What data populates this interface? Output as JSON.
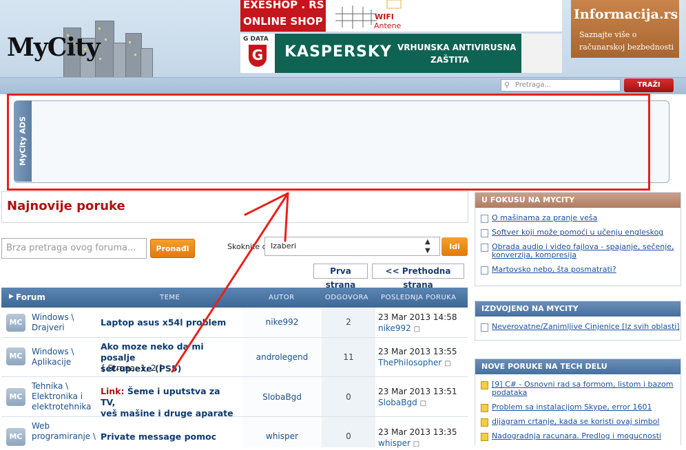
{
  "header": {
    "logo": "MyCity",
    "banner_exeshop_line1": "EXESHOP . RS",
    "banner_exeshop_line2": "ONLINE SHOP",
    "banner_wifi_line1": "WIFI",
    "banner_wifi_line2": "Antene",
    "banner_gdata": "G DATA",
    "banner_kaspersky": "KASPERSKY",
    "banner_kaspersky_line1": "VRHUNSKA ANTIVIRUSNA",
    "banner_kaspersky_line2": "ZAŠTITA",
    "banner_info_title": "Informacija.rs",
    "banner_info_line1": "Saznajte više o",
    "banner_info_line2": "računarskoj bezbednosti",
    "search_placeholder": "Pretraga...",
    "search_button": "TRAŽI"
  },
  "ads": {
    "label": "MyCity ADS"
  },
  "forum": {
    "title": "Najnovije poruke",
    "quick_search_placeholder": "Brza pretraga ovog foruma...",
    "find_button": "Pronađi",
    "jump_label": "Skoknite do:",
    "jump_selected": "Izaberi",
    "go_button": "Idi",
    "first_page": "Prva strana",
    "prev_page": "<< Prethodna strana",
    "columns": {
      "forum": "Forum",
      "topics": "TEME",
      "author": "AUTOR",
      "replies": "ODGOVORA",
      "last": "POSLEDNJA PORUKA"
    },
    "rows": [
      {
        "icon": "MC",
        "forum_l1": "Windows \\",
        "forum_l2": "Drajveri",
        "forum_l3": "",
        "prefix": "",
        "topic_l1": "Laptop asus x54l problem",
        "topic_l2": "",
        "pages_label": "",
        "author": "nike992",
        "replies": "2",
        "last_date": "23 Mar 2013 14:58",
        "last_user": "nike992"
      },
      {
        "icon": "MC",
        "forum_l1": "Windows \\",
        "forum_l2": "Aplikacije",
        "forum_l3": "",
        "prefix": "",
        "topic_l1": "Ako moze neko da mi posalje",
        "topic_l2": "set-up.exe (PS5)",
        "pages_label": "[ Strana: 1, 2 ]",
        "author": "androlegend",
        "replies": "11",
        "last_date": "23 Mar 2013 13:55",
        "last_user": "ThePhilosopher"
      },
      {
        "icon": "MC",
        "forum_l1": "Tehnika \\",
        "forum_l2": "Elektronika i",
        "forum_l3": "elektrotehnika",
        "prefix": "Link:",
        "topic_l1": "Šeme i uputstva za TV,",
        "topic_l2": "veš mašine i druge aparate",
        "pages_label": "",
        "author": "SlobaBgd",
        "replies": "0",
        "last_date": "23 Mar 2013 13:51",
        "last_user": "SlobaBgd"
      },
      {
        "icon": "MC",
        "forum_l1": "Web",
        "forum_l2": "programiranje \\",
        "forum_l3": "",
        "prefix": "",
        "topic_l1": "Private message pomoc",
        "topic_l2": "",
        "pages_label": "",
        "author": "whisper",
        "replies": "0",
        "last_date": "23 Mar 2013 13:35",
        "last_user": "whisper"
      }
    ]
  },
  "sidebar": {
    "focus_title": "U FOKUSU NA MYCITY",
    "focus_items": [
      "O mašinama za pranje veša",
      "Softver koji može pomoći u učenju engleskog",
      "Obrada audio i video fajlova - spajanje, sečenje, konverzija, kompresija",
      "Martovsko nebo, šta posmatrati?"
    ],
    "featured_title": "IZDVOJENO NA MYCITY",
    "featured_items": [
      "Neverovatne/Zanimljive Cinjenice [Iz svih oblasti]"
    ],
    "tech_title": "NOVE PORUKE NA TECH DELU",
    "tech_items": [
      "[9] C# - Osnovni rad sa formom, listom i bazom podataka",
      "Problem sa instalacijom Skype, error 1601",
      "dijagram crtanje, kada se koristi ovaj simbol",
      "Nadogradnja racunara. Predlog i mogucnosti"
    ]
  },
  "colors": {
    "annotation_red": "#e8201c",
    "header_blue": "#46709f",
    "accent_orange": "#e07a0d"
  }
}
